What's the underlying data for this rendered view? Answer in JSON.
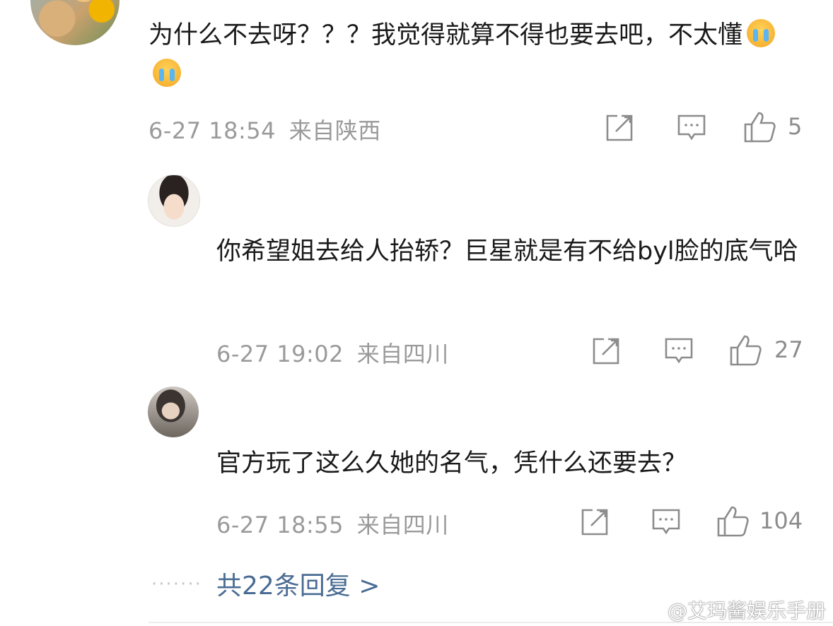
{
  "main_comment": {
    "text": "为什么不去呀？？？我觉得就算不得也要去吧，不太懂",
    "emojis": [
      "crying-face-icon",
      "crying-face-icon"
    ],
    "date": "6-27 18:54",
    "location": "来自陕西",
    "likes": "5"
  },
  "replies": [
    {
      "username": "",
      "text": "你希望姐去给人抬轿？巨星就是有不给byl脸的底气哈",
      "date": "6-27 19:02",
      "location": "来自四川",
      "likes": "27"
    },
    {
      "username": "",
      "text": "官方玩了这么久她的名气，凭什么还要去？",
      "date": "6-27 18:55",
      "location": "来自四川",
      "likes": "104"
    }
  ],
  "more_replies": {
    "dots": "·······",
    "label": "共22条回复 >"
  },
  "watermark": "@艾玛酱娱乐手册",
  "colors": {
    "link": "#4a6c93",
    "meta": "#9a9a9a",
    "icon": "#8c8c8c"
  }
}
